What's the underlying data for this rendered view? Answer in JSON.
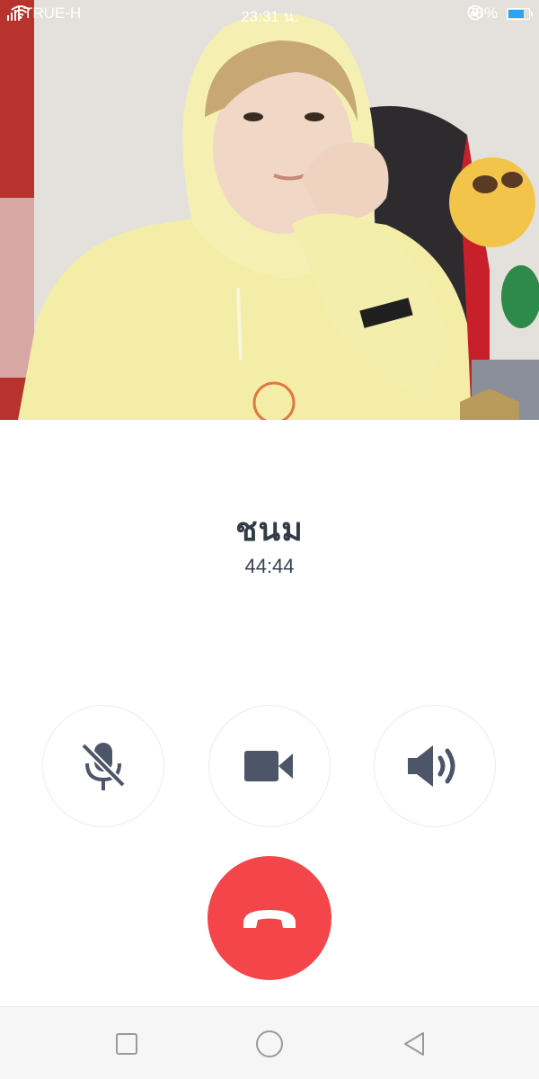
{
  "status_bar": {
    "carrier": "TRUE-H",
    "time": "23:31 น.",
    "battery_percent": "78%",
    "battery_level": 0.78,
    "icons": [
      "signal-icon",
      "wifi-icon",
      "rotation-lock-icon",
      "battery-icon"
    ]
  },
  "call": {
    "caller_name": "ชนม",
    "duration": "44:44"
  },
  "controls": {
    "mute_icon": "microphone-muted-icon",
    "video_icon": "video-camera-icon",
    "speaker_icon": "speaker-icon",
    "end_call_icon": "phone-hangup-icon"
  },
  "navigation": {
    "icons": [
      "recent-apps-icon",
      "home-icon",
      "back-icon"
    ]
  },
  "colors": {
    "end_call": "#f4454a",
    "icon": "#4d5568",
    "text": "#333b47",
    "battery_fill": "#2fa3f0"
  }
}
